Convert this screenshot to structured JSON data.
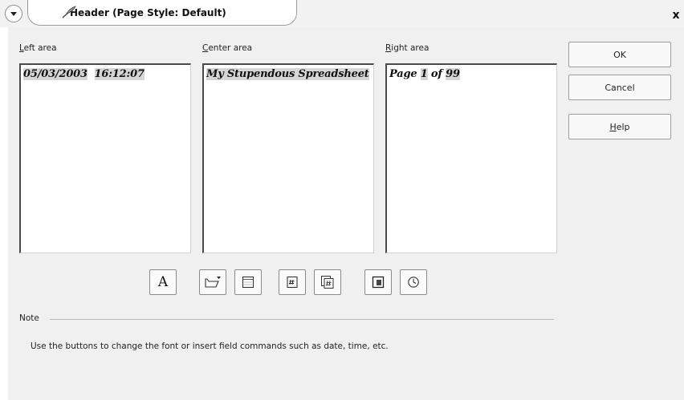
{
  "window": {
    "title": "Header (Page Style: Default)",
    "close_glyph": "x"
  },
  "areas": [
    {
      "mnemonic": "L",
      "label_rest": "eft area",
      "content_parts": [
        "05/03/2003",
        "16:12:07"
      ]
    },
    {
      "mnemonic": "C",
      "label_rest": "enter area",
      "content_parts": [
        "My Stupendous Spreadsheet"
      ]
    },
    {
      "mnemonic": "R",
      "label_rest": "ight area",
      "content_parts": [
        "Page ",
        "1",
        " of ",
        "99"
      ]
    }
  ],
  "buttons": {
    "ok": "OK",
    "cancel": "Cancel",
    "help_mnemonic": "H",
    "help_rest": "elp"
  },
  "toolbar": {
    "font_button_glyph": "A",
    "icons": [
      "text-attributes-icon",
      "file-name-icon",
      "sheet-name-icon",
      "page-icon",
      "pages-icon",
      "date-icon",
      "time-icon"
    ]
  },
  "note": {
    "label": "Note",
    "text": "Use the buttons to change the font or insert field commands such as date, time, etc."
  },
  "colors": {
    "dialog_bg": "#f0f0f0",
    "field_highlight": "#d6d6d6"
  }
}
